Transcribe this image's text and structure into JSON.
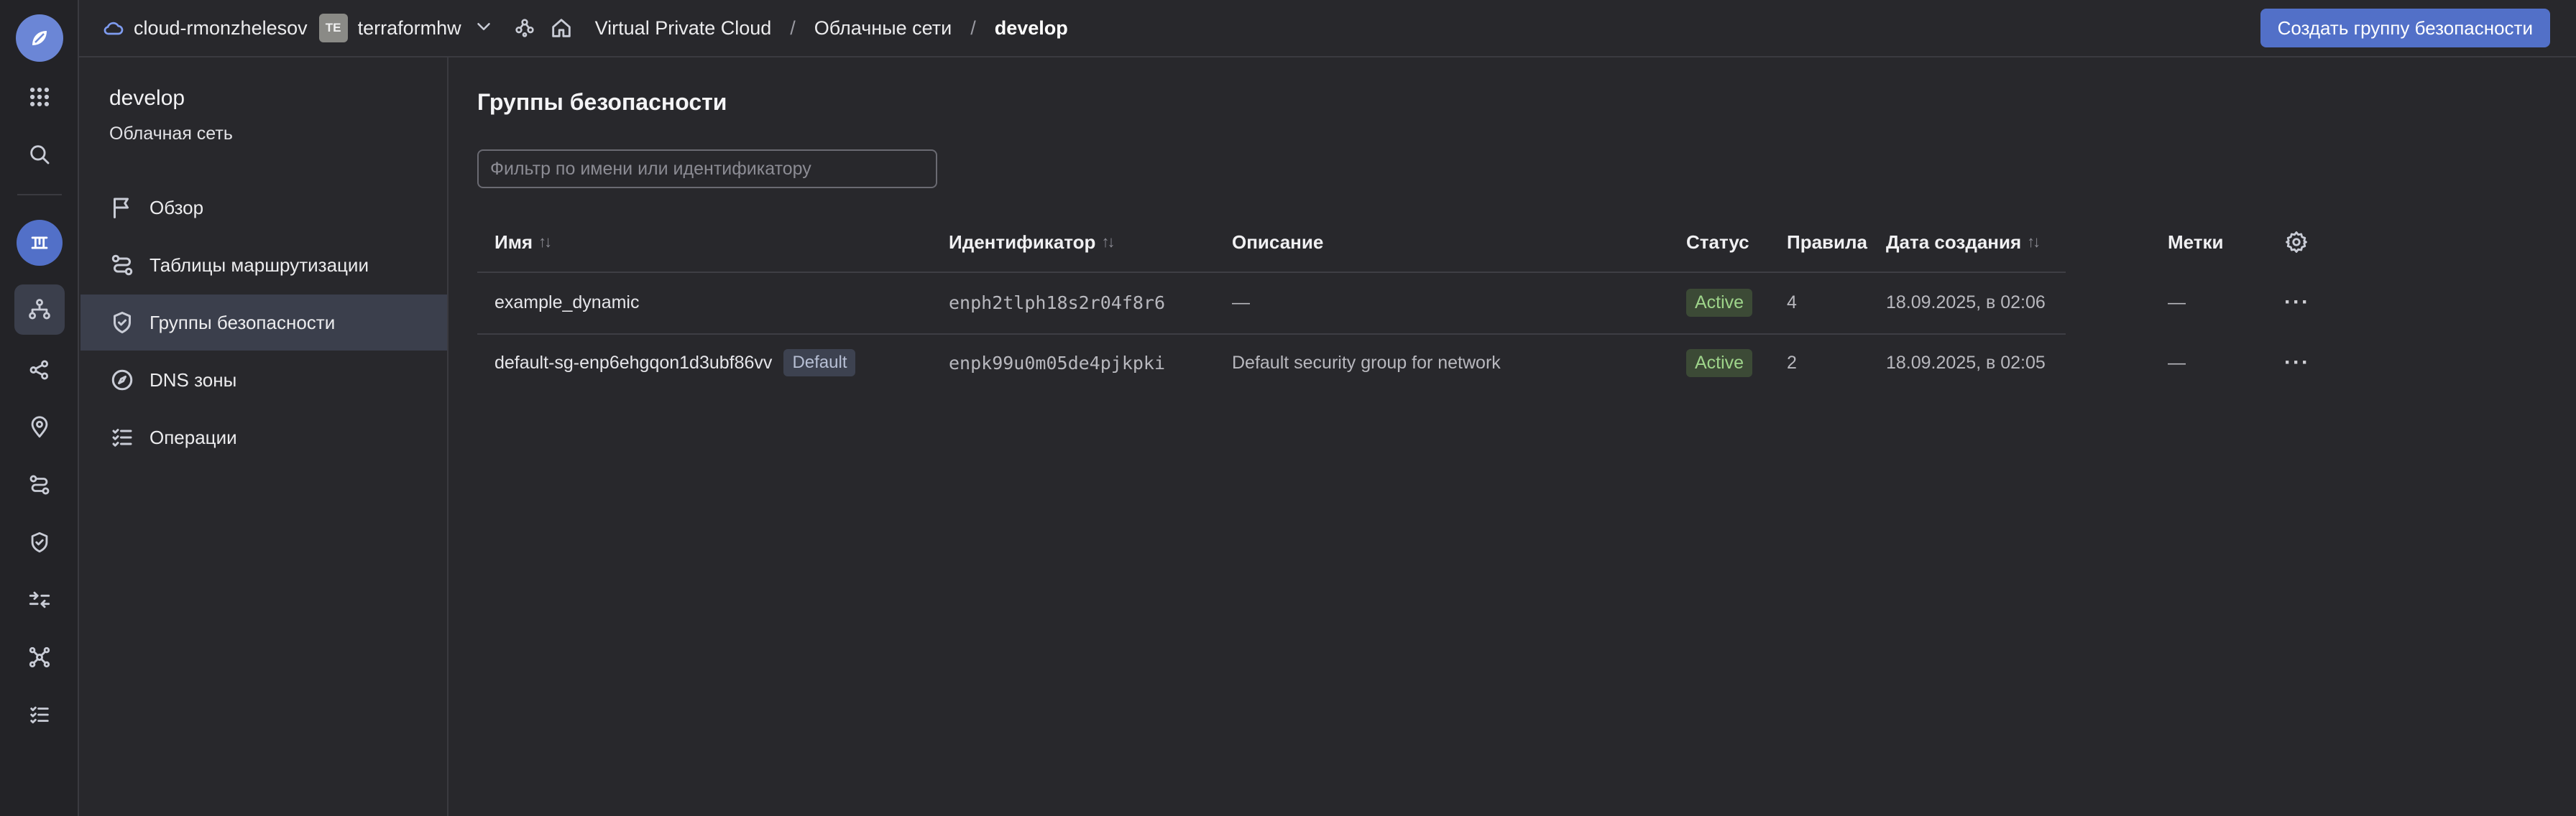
{
  "topbar": {
    "cloud_name": "cloud-rmonzhelesov",
    "folder_badge": "TE",
    "folder_name": "terraformhw",
    "breadcrumbs": [
      "Virtual Private Cloud",
      "Облачные сети",
      "develop"
    ],
    "breadcrumb_separator": "/",
    "create_button": "Создать группу безопасности"
  },
  "subnav": {
    "title": "develop",
    "subtitle": "Облачная сеть",
    "items": [
      {
        "label": "Обзор",
        "icon": "flag-icon"
      },
      {
        "label": "Таблицы маршрутизации",
        "icon": "route-icon"
      },
      {
        "label": "Группы безопасности",
        "icon": "shield-icon",
        "active": true
      },
      {
        "label": "DNS зоны",
        "icon": "compass-icon"
      },
      {
        "label": "Операции",
        "icon": "list-check-icon"
      }
    ]
  },
  "main": {
    "title": "Группы безопасности",
    "filter_placeholder": "Фильтр по имени или идентификатору",
    "columns": {
      "name": "Имя",
      "id": "Идентификатор",
      "description": "Описание",
      "status": "Статус",
      "rules": "Правила",
      "created": "Дата создания",
      "labels": "Метки"
    },
    "rows": [
      {
        "name": "example_dynamic",
        "badge": "",
        "id": "enph2tlph18s2r04f8r6",
        "description": "—",
        "status": "Active",
        "rules": "4",
        "created": "18.09.2025, в 02:06",
        "labels": "—"
      },
      {
        "name": "default-sg-enp6ehgqon1d3ubf86vv",
        "badge": "Default",
        "id": "enpk99u0m05de4pjkpki",
        "description": "Default security group for network",
        "status": "Active",
        "rules": "2",
        "created": "18.09.2025, в 02:05",
        "labels": "—"
      }
    ]
  },
  "colors": {
    "accent": "#5270c8",
    "background": "#28282c",
    "active_badge_bg": "#3c4a36",
    "active_badge_text": "#9ed48a"
  }
}
